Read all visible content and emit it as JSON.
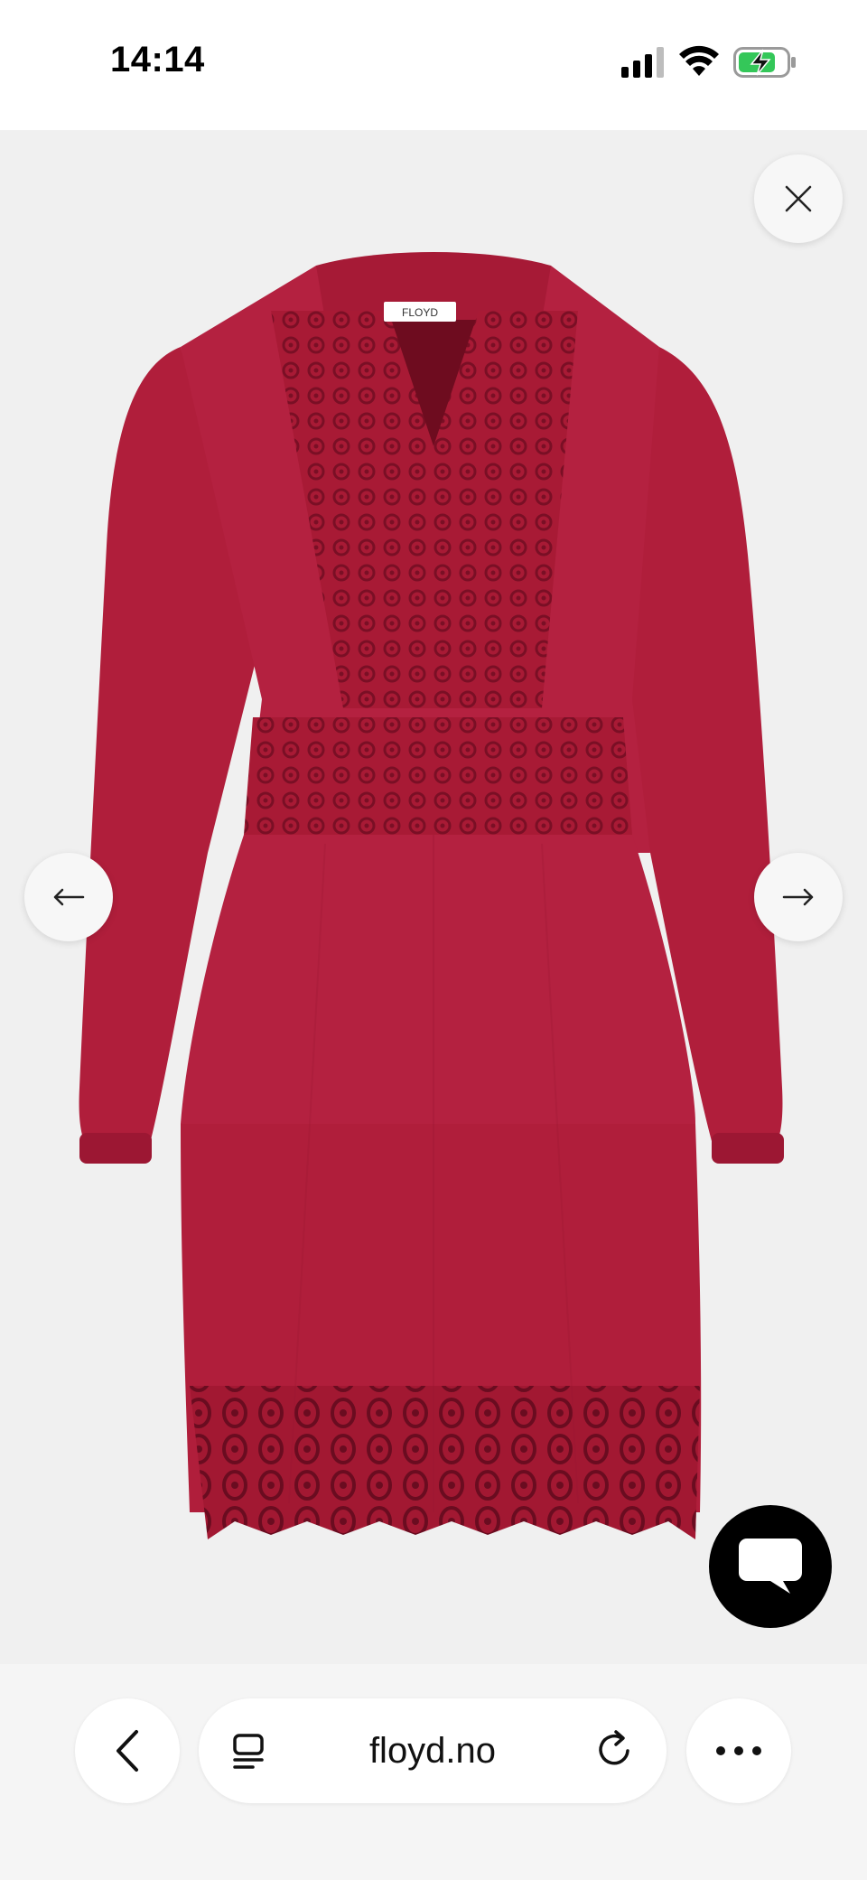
{
  "status_bar": {
    "time": "14:14"
  },
  "viewer": {
    "product_label_text": "FLOYD",
    "close_icon": "close-icon",
    "prev_icon": "arrow-left-icon",
    "next_icon": "arrow-right-icon",
    "chat_icon": "chat-bubble-icon",
    "dress_color": "#b8213f"
  },
  "browser": {
    "url": "floyd.no",
    "back_icon": "chevron-left-icon",
    "tabs_icon": "tabs-icon",
    "reload_icon": "reload-icon",
    "more_icon": "more-dots-icon"
  }
}
